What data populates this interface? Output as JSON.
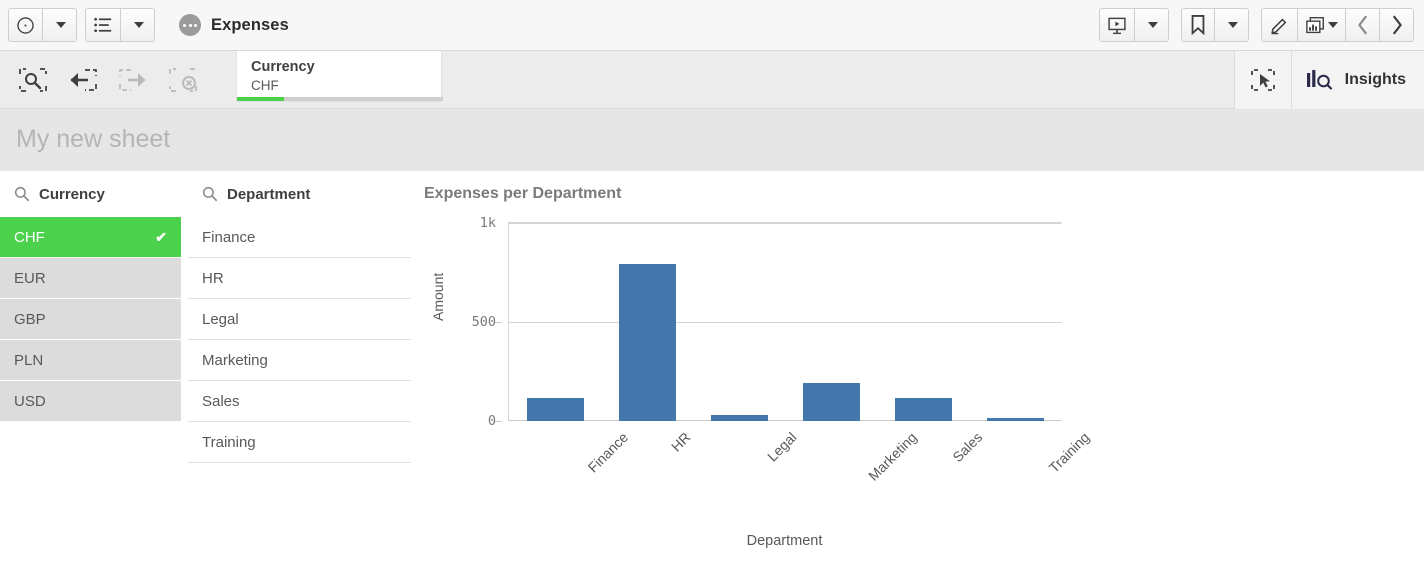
{
  "app": {
    "title": "Expenses"
  },
  "toolbar": {
    "left_buttons": [
      {
        "name": "navigation-menu",
        "icon": "compass-icon",
        "has_caret": true
      },
      {
        "name": "sheet-list",
        "icon": "list-icon",
        "has_caret": true
      }
    ],
    "right_buttons": [
      {
        "name": "storytelling",
        "icon": "presentation-icon",
        "has_caret": true
      },
      {
        "name": "bookmarks",
        "icon": "bookmark-icon",
        "has_caret": true
      },
      {
        "name": "edit-sheet",
        "icon": "pencil-icon",
        "has_caret": false
      },
      {
        "name": "sheets",
        "icon": "charts-icon",
        "has_caret": true
      },
      {
        "name": "previous-sheet",
        "icon": "chevron-left-icon",
        "has_caret": false
      },
      {
        "name": "next-sheet",
        "icon": "chevron-right-icon",
        "has_caret": false
      }
    ]
  },
  "selection_bar": {
    "tools": [
      {
        "name": "selections-tool",
        "icon": "selection-search-icon",
        "disabled": false
      },
      {
        "name": "step-back",
        "icon": "undo-icon",
        "disabled": false
      },
      {
        "name": "step-forward",
        "icon": "redo-icon",
        "disabled": true
      },
      {
        "name": "clear-all-selections",
        "icon": "clear-selection-icon",
        "disabled": true
      }
    ],
    "chip": {
      "field": "Currency",
      "value": "CHF"
    },
    "lasso_icon": "lasso-select-icon",
    "insights": {
      "label": "Insights",
      "icon": "insights-icon"
    }
  },
  "sheet": {
    "title": "My new sheet"
  },
  "filters": [
    {
      "name": "currency",
      "title": "Currency",
      "search_icon": "search-icon",
      "style": "currency",
      "items": [
        {
          "label": "CHF",
          "selected": true
        },
        {
          "label": "EUR",
          "selected": false
        },
        {
          "label": "GBP",
          "selected": false
        },
        {
          "label": "PLN",
          "selected": false
        },
        {
          "label": "USD",
          "selected": false
        }
      ]
    },
    {
      "name": "department",
      "title": "Department",
      "search_icon": "search-icon",
      "style": "department",
      "items": [
        {
          "label": "Finance",
          "selected": false
        },
        {
          "label": "HR",
          "selected": false
        },
        {
          "label": "Legal",
          "selected": false
        },
        {
          "label": "Marketing",
          "selected": false
        },
        {
          "label": "Sales",
          "selected": false
        },
        {
          "label": "Training",
          "selected": false
        }
      ]
    }
  ],
  "colors": {
    "selected_green": "#4cd14c",
    "bar_blue": "#4478ac",
    "text_grey": "#595959",
    "title_grey": "#7a7a7a"
  },
  "chart_data": {
    "type": "bar",
    "title": "Expenses per Department",
    "xlabel": "Department",
    "ylabel": "Amount",
    "categories": [
      "Finance",
      "HR",
      "Legal",
      "Marketing",
      "Sales",
      "Training"
    ],
    "values": [
      118,
      791,
      32,
      193,
      118,
      15
    ],
    "ylim": [
      0,
      1000
    ],
    "yticks": [
      0,
      500,
      1000
    ],
    "ytick_labels": [
      "0",
      "500",
      "1k"
    ],
    "grid": true,
    "legend": "none",
    "series_color": "#4478ac"
  }
}
